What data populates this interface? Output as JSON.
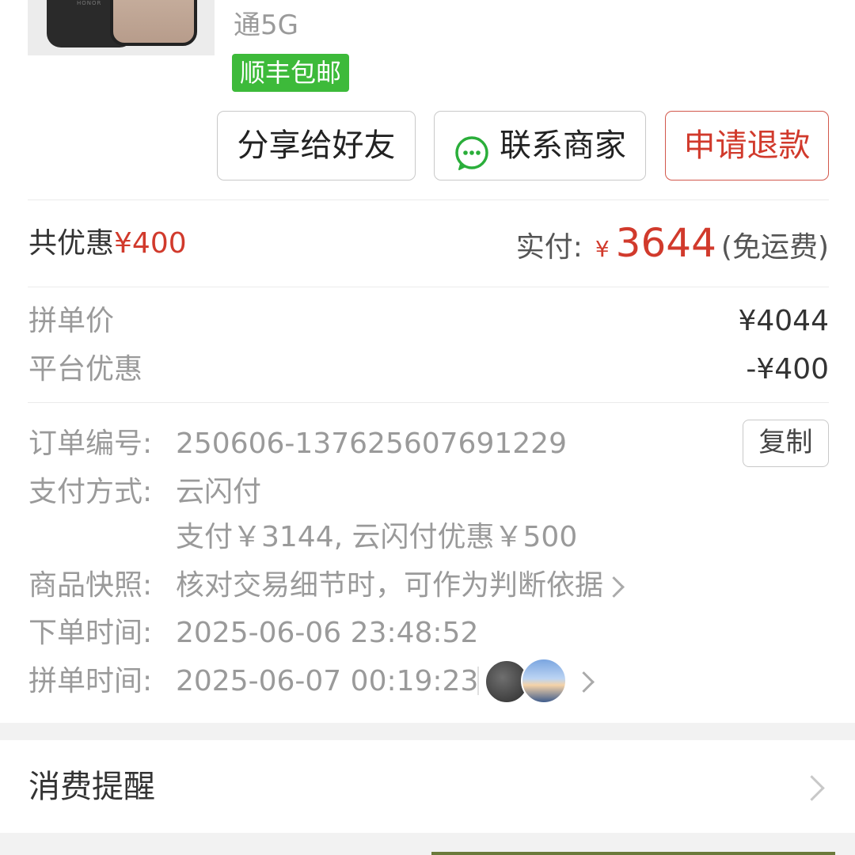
{
  "product": {
    "title_tail": "通5G",
    "shipping_tag": "顺丰包邮",
    "thumbnail_brand": "HONOR"
  },
  "actions": {
    "share": "分享给好友",
    "contact": "联系商家",
    "refund": "申请退款"
  },
  "summary": {
    "discount_label": "共优惠",
    "discount_amount": "¥400",
    "paid_label": "实付:",
    "paid_currency": "¥",
    "paid_amount": "3644",
    "paid_note": "(免运费)"
  },
  "price_breakdown": [
    {
      "label": "拼单价",
      "value": "¥4044"
    },
    {
      "label": "平台优惠",
      "value": "-¥400"
    }
  ],
  "order_info": {
    "order_no_label": "订单编号:",
    "order_no": "250606-137625607691229",
    "copy_label": "复制",
    "payment_label": "支付方式:",
    "payment_method": "云闪付",
    "payment_detail": "支付￥3144, 云闪付优惠￥500",
    "snapshot_label": "商品快照:",
    "snapshot_text": "核对交易细节时，可作为判断依据",
    "order_time_label": "下单时间:",
    "order_time": "2025-06-06 23:48:52",
    "group_time_label": "拼单时间:",
    "group_time": "2025-06-07 00:19:23"
  },
  "reminder": {
    "label": "消费提醒"
  },
  "colors": {
    "accent_red": "#d13a2c",
    "ship_green": "#3dba3a",
    "wechat_green": "#2aae3a"
  }
}
